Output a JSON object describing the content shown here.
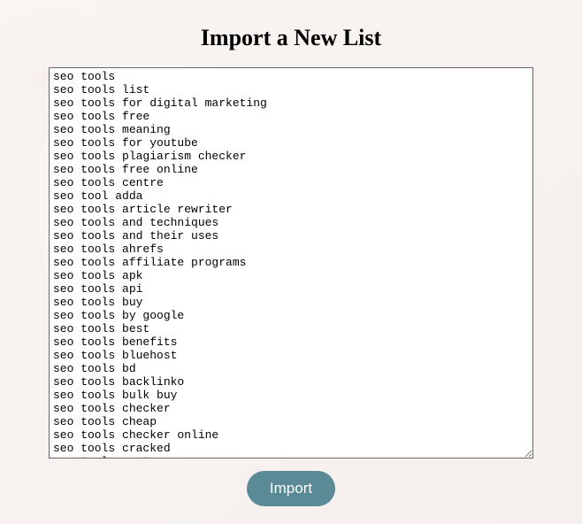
{
  "page": {
    "title": "Import a New List"
  },
  "form": {
    "textarea_value": "seo tools\nseo tools list\nseo tools for digital marketing\nseo tools free\nseo tools meaning\nseo tools for youtube\nseo tools plagiarism checker\nseo tools free online\nseo tools centre\nseo tool adda\nseo tools article rewriter\nseo tools and techniques\nseo tools and their uses\nseo tools ahrefs\nseo tools affiliate programs\nseo tools apk\nseo tools api\nseo tools buy\nseo tools by google\nseo tools best\nseo tools benefits\nseo tools bluehost\nseo tools bd\nseo tools backlinko\nseo tools bulk buy\nseo tools checker\nseo tools cheap\nseo tools checker online\nseo tools cracked\nseo tools cast",
    "import_button_label": "Import"
  }
}
